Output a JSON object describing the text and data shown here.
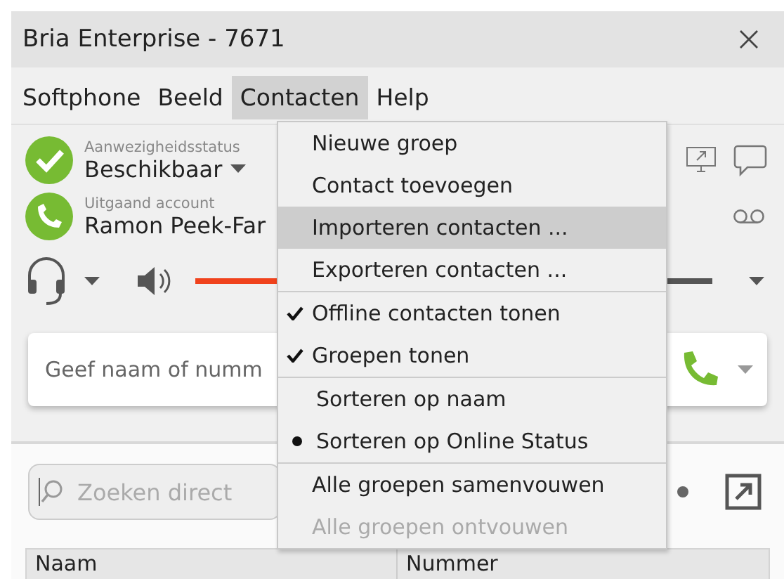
{
  "window": {
    "title": "Bria Enterprise - 7671"
  },
  "menubar": [
    {
      "label": "Softphone",
      "selected": false
    },
    {
      "label": "Beeld",
      "selected": false
    },
    {
      "label": "Contacten",
      "selected": true
    },
    {
      "label": "Help",
      "selected": false
    }
  ],
  "presence": {
    "label": "Aanwezigheidsstatus",
    "value": "Beschikbaar"
  },
  "account": {
    "label": "Uitgaand account",
    "value": "Ramon Peek-Far"
  },
  "audio": {
    "level": 0.5
  },
  "call_field": {
    "placeholder": "Geef naam of numm"
  },
  "search": {
    "placeholder": "Zoeken direct"
  },
  "table": {
    "columns": [
      "Naam",
      "Nummer"
    ]
  },
  "menu": {
    "groups": [
      [
        {
          "kind": "plain",
          "label": "Nieuwe groep",
          "highlighted": false,
          "disabled": false
        },
        {
          "kind": "plain",
          "label": "Contact toevoegen",
          "highlighted": false,
          "disabled": false
        },
        {
          "kind": "plain",
          "label": "Importeren contacten ...",
          "highlighted": true,
          "disabled": false
        },
        {
          "kind": "plain",
          "label": "Exporteren contacten ...",
          "highlighted": false,
          "disabled": false
        }
      ],
      [
        {
          "kind": "check",
          "label": "Offline contacten tonen",
          "checked": true,
          "highlighted": false,
          "disabled": false
        },
        {
          "kind": "check",
          "label": "Groepen tonen",
          "checked": true,
          "highlighted": false,
          "disabled": false
        }
      ],
      [
        {
          "kind": "radio",
          "label": "Sorteren op naam",
          "selected": false,
          "highlighted": false,
          "disabled": false
        },
        {
          "kind": "radio",
          "label": "Sorteren op Online Status",
          "selected": true,
          "highlighted": false,
          "disabled": false
        }
      ],
      [
        {
          "kind": "plain",
          "label": "Alle groepen samenvouwen",
          "highlighted": false,
          "disabled": false
        },
        {
          "kind": "plain",
          "label": "Alle groepen ontvouwen",
          "highlighted": false,
          "disabled": true
        }
      ]
    ]
  }
}
